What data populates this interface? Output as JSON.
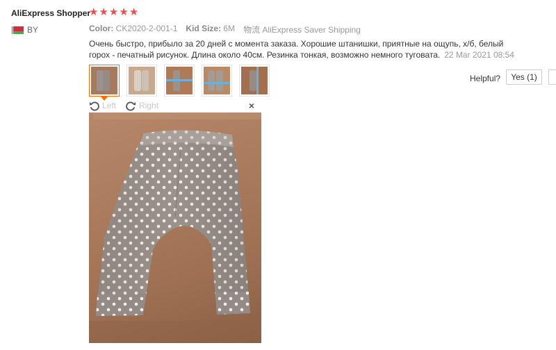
{
  "review": {
    "reviewer_name": "AliExpress Shopper",
    "rating": 5,
    "rating_max": 5,
    "country_code": "BY",
    "color_label": "Color:",
    "color_value": "CK2020-2-001-1",
    "size_label": "Kid Size:",
    "size_value": "6M",
    "shipping_text": "物流 AliExpress Saver Shipping",
    "text": "Очень быстро, прибыло за 20 дней с момента заказа. Хорошие штанишки, приятные на ощупь, х/б, белый горох - печатный рисунок. Длина около 40см. Резинка тонкая, возможно немного туговата.",
    "date": "22 Mar 2021 08:54"
  },
  "thumbnails": [
    {
      "name": "photo-1",
      "active": true
    },
    {
      "name": "photo-2",
      "active": false
    },
    {
      "name": "photo-3",
      "active": false
    },
    {
      "name": "photo-4",
      "active": false
    },
    {
      "name": "photo-5",
      "active": false
    }
  ],
  "helpful": {
    "label": "Helpful?",
    "yes_label": "Yes (1)"
  },
  "viewer": {
    "rotate_left_label": "Left",
    "rotate_right_label": "Right",
    "close_symbol": "×",
    "icons": [
      "rotate-left-icon",
      "rotate-right-icon",
      "close-icon"
    ]
  },
  "colors": {
    "star": "#f44b4b",
    "active_border": "#ff6a00",
    "pants_base": "#9c928c",
    "dots": "#f2efec"
  }
}
